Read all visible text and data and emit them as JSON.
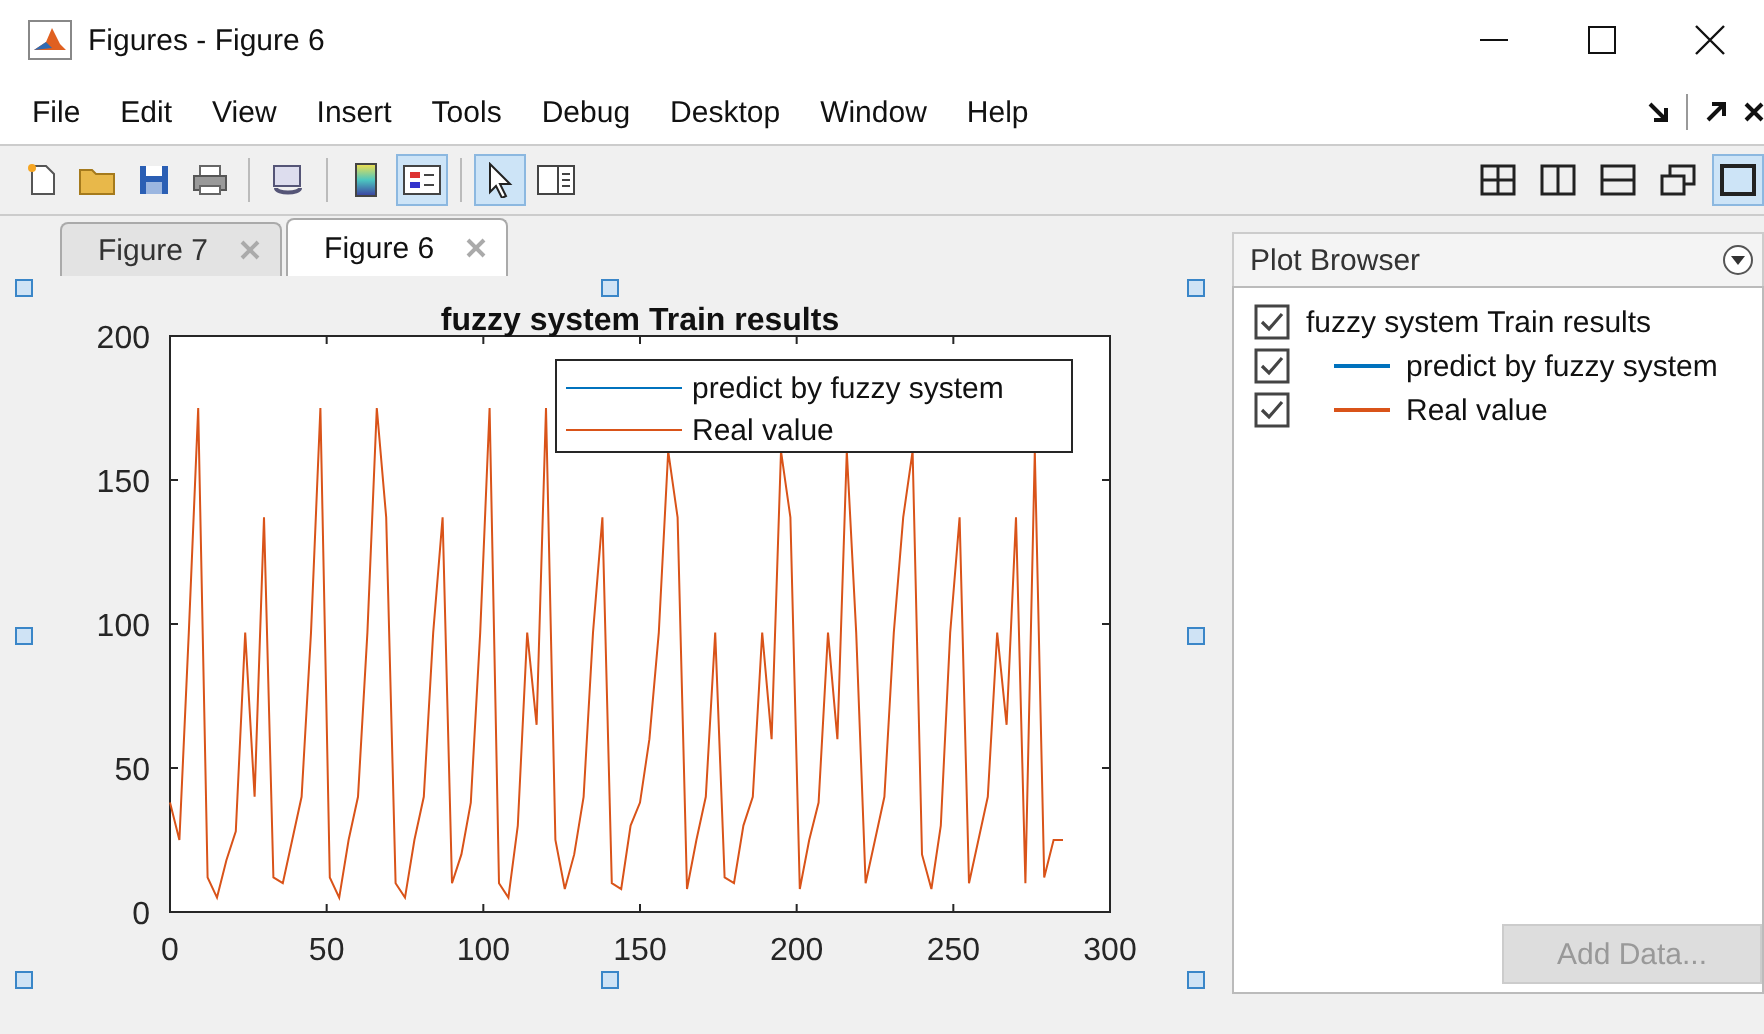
{
  "window": {
    "title": "Figures - Figure 6"
  },
  "menu": [
    "File",
    "Edit",
    "View",
    "Insert",
    "Tools",
    "Debug",
    "Desktop",
    "Window",
    "Help"
  ],
  "toolbar": [
    {
      "kind": "new",
      "selected": false
    },
    {
      "kind": "open",
      "selected": false
    },
    {
      "kind": "save",
      "selected": false
    },
    {
      "kind": "print",
      "selected": false
    },
    {
      "kind": "sep"
    },
    {
      "kind": "link",
      "selected": false
    },
    {
      "kind": "sep"
    },
    {
      "kind": "colorbar",
      "selected": false
    },
    {
      "kind": "legend",
      "selected": true
    },
    {
      "kind": "sep"
    },
    {
      "kind": "pointer",
      "selected": true
    },
    {
      "kind": "inspector",
      "selected": false
    }
  ],
  "layout_buttons": [
    {
      "kind": "grid",
      "selected": false
    },
    {
      "kind": "columns",
      "selected": false
    },
    {
      "kind": "rows",
      "selected": false
    },
    {
      "kind": "float",
      "selected": false
    },
    {
      "kind": "single",
      "selected": true
    }
  ],
  "tabs": [
    {
      "label": "Figure 7",
      "selected": false
    },
    {
      "label": "Figure 6",
      "selected": true
    }
  ],
  "figure": {
    "chart_data": {
      "type": "line",
      "legend": "top right",
      "title": "fuzzy system Train results",
      "xlim": [
        0,
        300
      ],
      "ylim": [
        0,
        200
      ],
      "xticks": [
        0,
        50,
        100,
        150,
        200,
        250,
        300
      ],
      "yticks": [
        0,
        50,
        100,
        150,
        200
      ],
      "x": [
        0,
        3,
        6,
        9,
        12,
        15,
        18,
        21,
        24,
        27,
        30,
        33,
        36,
        39,
        42,
        45,
        48,
        51,
        54,
        57,
        60,
        63,
        66,
        69,
        72,
        75,
        78,
        81,
        84,
        87,
        90,
        93,
        96,
        99,
        102,
        105,
        108,
        111,
        114,
        117,
        120,
        123,
        126,
        129,
        132,
        135,
        138,
        141,
        144,
        147,
        150,
        153,
        156,
        159,
        162,
        165,
        168,
        171,
        174,
        177,
        180,
        183,
        186,
        189,
        192,
        195,
        198,
        201,
        204,
        207,
        210,
        213,
        216,
        219,
        222,
        225,
        228,
        231,
        234,
        237,
        240,
        243,
        246,
        249,
        252,
        255,
        258,
        261,
        264,
        267,
        270,
        273,
        276,
        279,
        282,
        285
      ],
      "series": [
        {
          "name": "predict by fuzzy system",
          "color": "#0072bd",
          "values": [
            null,
            null,
            null,
            null,
            null,
            null,
            null,
            null,
            null,
            null,
            null,
            null,
            null,
            null,
            null,
            null,
            null,
            null,
            null,
            null,
            null,
            null,
            null,
            null,
            null,
            null,
            null,
            null,
            null,
            null,
            null,
            null,
            null,
            null,
            null,
            null,
            null,
            null,
            null,
            null,
            null,
            null,
            null,
            null,
            null,
            null,
            null,
            null,
            null,
            null,
            null,
            null,
            null,
            null,
            null,
            null,
            null,
            null,
            null,
            null,
            null,
            null,
            null,
            null,
            null,
            null,
            null,
            null,
            null,
            null,
            null,
            null,
            null,
            null,
            null,
            null,
            null,
            null,
            null,
            null,
            null,
            null,
            null,
            null,
            null,
            null,
            null,
            null,
            null,
            null,
            null,
            null,
            null,
            null,
            null,
            null
          ]
        },
        {
          "name": "Real value",
          "color": "#d95319",
          "values": [
            38,
            25,
            97,
            175,
            12,
            5,
            18,
            28,
            97,
            40,
            137,
            12,
            10,
            25,
            40,
            97,
            175,
            12,
            5,
            25,
            40,
            97,
            175,
            137,
            10,
            5,
            25,
            40,
            97,
            137,
            10,
            20,
            38,
            97,
            175,
            10,
            5,
            30,
            97,
            65,
            175,
            25,
            8,
            20,
            40,
            97,
            137,
            10,
            8,
            30,
            38,
            60,
            97,
            160,
            137,
            8,
            25,
            40,
            97,
            12,
            10,
            30,
            40,
            97,
            60,
            160,
            137,
            8,
            25,
            38,
            97,
            60,
            160,
            97,
            10,
            25,
            40,
            97,
            137,
            160,
            20,
            8,
            30,
            97,
            137,
            10,
            25,
            40,
            97,
            65,
            137,
            10,
            160,
            12,
            25,
            25
          ]
        }
      ]
    }
  },
  "plot_browser": {
    "title": "Plot Browser",
    "items": [
      {
        "label": "fuzzy system Train results",
        "checked": true,
        "children": [
          {
            "label": "predict by fuzzy system",
            "checked": true,
            "color": "#0072bd"
          },
          {
            "label": "Real value",
            "checked": true,
            "color": "#d95319"
          }
        ]
      }
    ],
    "add_button": {
      "label": "Add Data...",
      "disabled": true
    }
  }
}
